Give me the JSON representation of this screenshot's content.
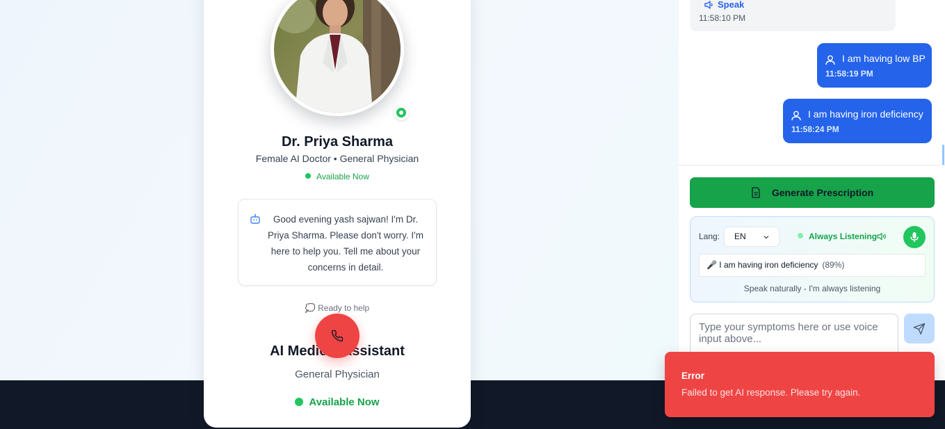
{
  "doctor": {
    "name": "Dr. Priya Sharma",
    "role": "Female AI Doctor • General Physician",
    "availability": "Available Now",
    "greeting": "Good evening yash sajwan! I'm Dr. Priya Sharma. Please don't worry. I'm here to help you. Tell me about your concerns in detail.",
    "status_text": "💭 Ready to help"
  },
  "assistant": {
    "title": "AI Medical Assistant",
    "specialty": "General Physician",
    "availability": "Available Now"
  },
  "chat": {
    "bot_message": {
      "speak_label": "Speak",
      "time": "11:58:10 PM"
    },
    "user_messages": [
      {
        "text": "I am having low BP",
        "time": "11:58:19 PM"
      },
      {
        "text": "I am having iron deficiency",
        "time": "11:58:24 PM"
      }
    ]
  },
  "prescription_button": "Generate Prescription",
  "voice": {
    "lang_label": "Lang:",
    "lang_value": "EN",
    "listening_label": "Always Listening",
    "transcript": "I am having iron deficiency",
    "confidence": "(89%)",
    "hint": "Speak naturally - I'm always listening"
  },
  "input": {
    "placeholder": "Type your symptoms here or use voice input above..."
  },
  "toast": {
    "title": "Error",
    "message": "Failed to get AI response. Please try again."
  },
  "colors": {
    "primary_blue": "#2563eb",
    "success_green": "#16a34a",
    "error_red": "#ef4444",
    "footer_dark": "#111827"
  }
}
